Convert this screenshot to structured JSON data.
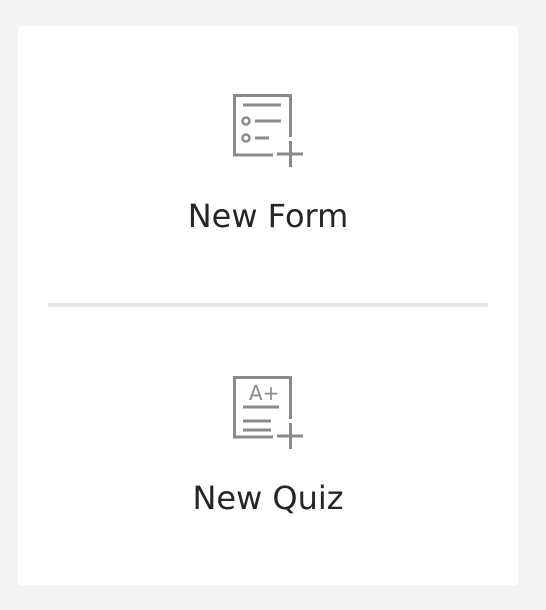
{
  "options": {
    "form": {
      "label": "New Form",
      "icon": "form-add-icon"
    },
    "quiz": {
      "label": "New Quiz",
      "icon": "quiz-add-icon",
      "icon_text": "A+"
    }
  },
  "colors": {
    "background": "#f3f3f3",
    "card": "#ffffff",
    "icon": "#8a8a8a",
    "text": "#252525",
    "divider": "#e6e6e6"
  }
}
